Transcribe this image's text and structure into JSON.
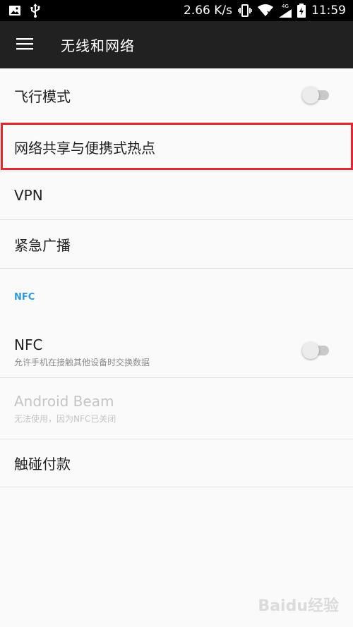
{
  "status_bar": {
    "network_speed": "2.66 K/s",
    "signal_label": "4G",
    "time": "11:59",
    "icons": [
      "image-icon",
      "usb-icon",
      "vibrate-icon",
      "wifi-icon",
      "cell-signal-icon",
      "battery-charging-icon"
    ]
  },
  "app_bar": {
    "title": "无线和网络",
    "menu_icon": "hamburger-menu-icon"
  },
  "settings": {
    "airplane_mode": {
      "label": "飞行模式",
      "enabled": false
    },
    "tethering": {
      "label": "网络共享与便携式热点",
      "highlighted": true
    },
    "vpn": {
      "label": "VPN"
    },
    "emergency_broadcast": {
      "label": "紧急广播"
    },
    "nfc_section_header": "NFC",
    "nfc": {
      "label": "NFC",
      "summary": "允许手机在接触其他设备时交换数据",
      "enabled": false
    },
    "android_beam": {
      "label": "Android Beam",
      "summary": "无法使用，因为NFC已关闭",
      "disabled": true
    },
    "tap_and_pay": {
      "label": "触碰付款"
    }
  },
  "colors": {
    "app_bar": "#212121",
    "accent": "#2f9ad6",
    "highlight_border": "#e0282e"
  },
  "watermark": "Baidu经验"
}
